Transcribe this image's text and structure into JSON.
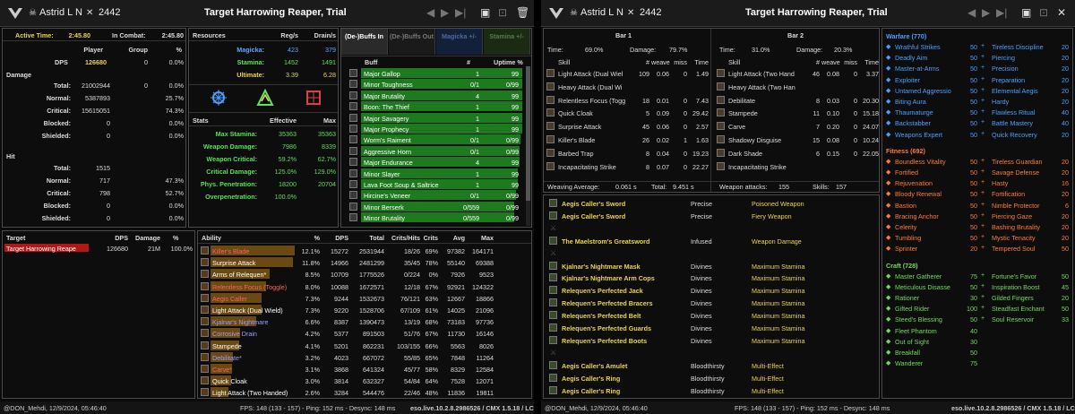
{
  "header": {
    "skull": "☠",
    "player": "Astrid L N",
    "bow": "✕",
    "number": "2442",
    "title": "Target Harrowing Reaper, Trial"
  },
  "footer": {
    "user": "@DON_Mehdi, 12/9/2024, 05:46:40",
    "fps": "FPS: 148  (133 - 157)  - Ping: 152 ms - Desync: 148 ms",
    "server": "eso.live.10.2.8.2986526 / CMX 1.5.18 / LC 75"
  },
  "summary": {
    "active_label": "Active Time:",
    "active": "2:45.80",
    "combat_label": "In Combat:",
    "combat": "2:45.80",
    "cols": [
      "Player",
      "Group",
      "%"
    ],
    "dps": [
      "DPS",
      "126680",
      "0",
      "0.0%"
    ],
    "damage_label": "Damage",
    "damage": [
      [
        "Total:",
        "21002944",
        "0",
        "0.0%"
      ],
      [
        "Normal:",
        "5387893",
        "",
        "25.7%"
      ],
      [
        "Critical:",
        "15615051",
        "",
        "74.3%"
      ],
      [
        "Blocked:",
        "0",
        "",
        "0.0%"
      ],
      [
        "Shielded:",
        "0",
        "",
        "0.0%"
      ]
    ],
    "hit_label": "Hit",
    "hit": [
      [
        "Total:",
        "1515",
        "",
        ""
      ],
      [
        "Normal:",
        "717",
        "",
        "47.3%"
      ],
      [
        "Critical:",
        "798",
        "",
        "52.7%"
      ],
      [
        "Blocked:",
        "0",
        "",
        "0.0%"
      ],
      [
        "Shielded:",
        "0",
        "",
        "0.0%"
      ]
    ]
  },
  "resources": {
    "cols": [
      "Resources",
      "Reg/s",
      "Drain/s"
    ],
    "rows": [
      [
        "Magicka:",
        "423",
        "379",
        "#5aa8ff"
      ],
      [
        "Stamina:",
        "1452",
        "1491",
        "#60e060"
      ],
      [
        "Ultimate:",
        "3.39",
        "6.28",
        "#e8d44d"
      ]
    ]
  },
  "stats": {
    "cols": [
      "Stats",
      "Effective",
      "Max"
    ],
    "rows": [
      [
        "Max Stamina:",
        "35363",
        "35363"
      ],
      [
        "Weapon Damage:",
        "7986",
        "8339"
      ],
      [
        "Weapon Critical:",
        "59.2%",
        "62.7%"
      ],
      [
        "Critical Damage:",
        "125.0%",
        "129.0%"
      ],
      [
        "Phys. Penetration:",
        "18200",
        "20704"
      ],
      [
        "Overpenetration:",
        "100.0%",
        ""
      ]
    ]
  },
  "buffs": {
    "tabs": [
      "(De-)Buffs In",
      "(De-)Buffs Out",
      "Magicka +/-",
      "Stamina +/-"
    ],
    "cols": [
      "Buff",
      "#",
      "Uptime %"
    ],
    "rows": [
      [
        "Major Gallop",
        "1",
        "99",
        "#1e7a1e",
        0.99
      ],
      [
        "Minor Toughness",
        "0/1",
        "0/99",
        "#1e7a1e",
        0.99
      ],
      [
        "Major Brutality",
        "4",
        "99",
        "#1e7a1e",
        0.99
      ],
      [
        "Boon: The Thief",
        "1",
        "99",
        "#1e7a1e",
        0.99
      ],
      [
        "Major Savagery",
        "1",
        "99",
        "#1e7a1e",
        0.99
      ],
      [
        "Major Prophecy",
        "1",
        "99",
        "#1e7a1e",
        0.99
      ],
      [
        "Worm's Raiment",
        "0/1",
        "0/99",
        "#1e7a1e",
        0.98
      ],
      [
        "Aggressive Horn",
        "0/1",
        "0/99",
        "#1e7a1e",
        0.97
      ],
      [
        "Major Endurance",
        "4",
        "99",
        "#1e7a1e",
        0.97
      ],
      [
        "Minor Slayer",
        "1",
        "99",
        "#1e7a1e",
        0.96
      ],
      [
        "Lava Foot Soup & Saltrice",
        "1",
        "99",
        "#1e7a1e",
        0.96
      ],
      [
        "Hircine's Veneer",
        "0/1",
        "0/99",
        "#1e7a1e",
        0.95
      ],
      [
        "Minor Berserk",
        "0/559",
        "0/99",
        "#1e7a1e",
        0.94
      ],
      [
        "Minor Brutality",
        "0/559",
        "0/99",
        "#1e7a1e",
        0.94
      ]
    ]
  },
  "targets": {
    "cols": [
      "Target",
      "DPS",
      "Damage",
      "%"
    ],
    "rows": [
      [
        "Target Harrowing Reape",
        "126680",
        "21M",
        "100.0%"
      ]
    ]
  },
  "abilities": {
    "cols": [
      "Ability",
      "%",
      "DPS",
      "Total",
      "Crits/Hits",
      "Crits",
      "Avg",
      "Max"
    ],
    "rows": [
      [
        "Killer's Blade",
        "12.1%",
        "15272",
        "2531944",
        "18/26",
        "69%",
        "97382",
        "164171",
        "#ff6060"
      ],
      [
        "Surprise Attack",
        "11.8%",
        "14966",
        "2481299",
        "35/45",
        "78%",
        "55140",
        "69388",
        "#ffffff"
      ],
      [
        "Arms of Relequen*",
        "8.5%",
        "10709",
        "1775526",
        "0/224",
        "0%",
        "7926",
        "9523",
        "#ffffff"
      ],
      [
        "Relentless Focus (Toggle)",
        "8.0%",
        "10088",
        "1672571",
        "12/18",
        "67%",
        "92921",
        "124322",
        "#ff6060"
      ],
      [
        "Aegis Caller",
        "7.3%",
        "9244",
        "1532673",
        "76/121",
        "63%",
        "12667",
        "18866",
        "#ff6060"
      ],
      [
        "Light Attack (Dual Wield)",
        "7.3%",
        "9220",
        "1528706",
        "67/109",
        "61%",
        "14025",
        "21096",
        "#ffffff"
      ],
      [
        "Kjalnar's Nightmare",
        "6.6%",
        "8387",
        "1390473",
        "13/19",
        "68%",
        "73183",
        "97736",
        "#9f9fff"
      ],
      [
        "Corrosive Drain",
        "4.2%",
        "5377",
        "891503",
        "51/76",
        "67%",
        "11730",
        "16146",
        "#9f9fff"
      ],
      [
        "Stampede",
        "4.1%",
        "5201",
        "862231",
        "103/155",
        "66%",
        "5563",
        "8026",
        "#ffffff"
      ],
      [
        "Debilitate*",
        "3.2%",
        "4023",
        "667072",
        "55/85",
        "65%",
        "7848",
        "11264",
        "#9f9fff"
      ],
      [
        "Carve*",
        "3.1%",
        "3868",
        "641324",
        "45/77",
        "58%",
        "8329",
        "12584",
        "#ff6060"
      ],
      [
        "Quick Cloak",
        "3.0%",
        "3814",
        "632327",
        "54/84",
        "64%",
        "7528",
        "12071",
        "#ffffff"
      ],
      [
        "Light Attack (Two Handed)",
        "2.6%",
        "3284",
        "544476",
        "22/46",
        "48%",
        "11836",
        "19811",
        "#ffffff"
      ]
    ]
  },
  "bars": {
    "bar1": {
      "title": "Bar 1",
      "time_label": "Time:",
      "time": "69.0%",
      "damage_label": "Damage:",
      "damage": "79.7%"
    },
    "bar2": {
      "title": "Bar 2",
      "time_label": "Time:",
      "time": "31.0%",
      "damage_label": "Damage:",
      "damage": "20.3%"
    },
    "cols": [
      "Skill",
      "#",
      "weave",
      "miss",
      "Time"
    ],
    "rows1": [
      [
        "Light Attack (Dual Wiel",
        "109",
        "0.06",
        "0",
        "1.49"
      ],
      [
        "Heavy Attack (Dual Wi",
        "",
        "",
        "",
        ""
      ],
      [
        "Relentless Focus (Togg",
        "18",
        "0.01",
        "0",
        "7.43"
      ],
      [
        "Quick Cloak",
        "5",
        "0.09",
        "0",
        "29.42"
      ],
      [
        "Surprise Attack",
        "45",
        "0.06",
        "0",
        "2.57"
      ],
      [
        "Killer's Blade",
        "26",
        "0.02",
        "1",
        "1.63"
      ],
      [
        "Barbed Trap",
        "8",
        "0.04",
        "0",
        "19.23"
      ],
      [
        "Incapacitating Strike",
        "8",
        "0.07",
        "0",
        "22.27"
      ]
    ],
    "rows2": [
      [
        "Light Attack (Two Hand",
        "46",
        "0.08",
        "0",
        "3.37"
      ],
      [
        "Heavy Attack (Two Han",
        "",
        "",
        "",
        ""
      ],
      [
        "Debilitate",
        "8",
        "0.03",
        "0",
        "20.30"
      ],
      [
        "Stampede",
        "11",
        "0.10",
        "0",
        "15.18"
      ],
      [
        "Carve",
        "7",
        "0.20",
        "0",
        "24.07"
      ],
      [
        "Shadowy Disguise",
        "15",
        "0.08",
        "0",
        "10.24"
      ],
      [
        "Dark Shade",
        "6",
        "0.15",
        "0",
        "22.05"
      ],
      [
        "Incapacitating Strike",
        "",
        "",
        "",
        ""
      ]
    ],
    "weave_avg_label": "Weaving Average:",
    "weave_avg": "0.061 s",
    "total_label": "Total:",
    "total": "9.451 s",
    "weapon_attacks_label": "Weapon attacks:",
    "weapon_attacks": "155",
    "skills_label": "Skills:",
    "skills": "157"
  },
  "gear": [
    [
      "Aegis Caller's Sword",
      "Precise",
      "Poisoned Weapon"
    ],
    [
      "Aegis Caller's Sword",
      "Precise",
      "Fiery Weapon"
    ],
    [
      "",
      "",
      " "
    ],
    [
      "The Maelstrom's Greatsword",
      "Infused",
      "Weapon Damage"
    ],
    [
      "",
      "",
      ""
    ],
    [
      "Kjalnar's Nightmare Mask",
      "Divines",
      "Maximum Stamina"
    ],
    [
      "Kjalnar's Nightmare Arm Cops",
      "Divines",
      "Maximum Stamina"
    ],
    [
      "Relequen's Perfected Jack",
      "Divines",
      "Maximum Stamina"
    ],
    [
      "Relequen's Perfected Bracers",
      "Divines",
      "Maximum Stamina"
    ],
    [
      "Relequen's Perfected Belt",
      "Divines",
      "Maximum Stamina"
    ],
    [
      "Relequen's Perfected Guards",
      "Divines",
      "Maximum Stamina"
    ],
    [
      "Relequen's Perfected Boots",
      "Divines",
      "Maximum Stamina"
    ],
    [
      "",
      "",
      ""
    ],
    [
      "Aegis Caller's Amulet",
      "Bloodthirsty",
      "Multi-Effect"
    ],
    [
      "Aegis Caller's Ring",
      "Bloodthirsty",
      "Multi-Effect"
    ],
    [
      "Aegis Caller's Ring",
      "Bloodthirsty",
      "Multi-Effect"
    ]
  ],
  "cp": {
    "warfare": {
      "title": "Warfare (770)",
      "color": "#4aa0ff",
      "left": [
        [
          "Wrathful Strikes",
          "50"
        ],
        [
          "Deadly Aim",
          "50"
        ],
        [
          "Master-at-Arms",
          "50"
        ],
        [
          "Exploiter",
          "50"
        ],
        [
          "Untamed Aggressio",
          "50"
        ],
        [
          "Biting Aura",
          "50"
        ],
        [
          "Thaumaturge",
          "50"
        ],
        [
          "Backstabber",
          "50"
        ],
        [
          "Weapons Expert",
          "50"
        ]
      ],
      "right": [
        [
          "Tireless Discipline",
          "20"
        ],
        [
          "Piercing",
          "20"
        ],
        [
          "Precision",
          "20"
        ],
        [
          "Preparation",
          "20"
        ],
        [
          "Elemental Aegis",
          "20"
        ],
        [
          "Hardy",
          "20"
        ],
        [
          "Flawless Ritual",
          "40"
        ],
        [
          "Battle Mastery",
          "40"
        ],
        [
          "Quick Recovery",
          "20"
        ]
      ]
    },
    "fitness": {
      "title": "Fitness (692)",
      "color": "#ff7a3a",
      "left": [
        [
          "Boundless Vitality",
          "50"
        ],
        [
          "Fortified",
          "50"
        ],
        [
          "Rejuvenation",
          "50"
        ],
        [
          "Bloody Renewal",
          "50"
        ],
        [
          "Bastion",
          "50"
        ],
        [
          "Bracing Anchor",
          "50"
        ],
        [
          "Celerity",
          "50"
        ],
        [
          "Tumbling",
          "50"
        ],
        [
          "Sprinter",
          "20"
        ]
      ],
      "right": [
        [
          "Tireless Guardian",
          "20"
        ],
        [
          "Savage Defense",
          "20"
        ],
        [
          "Hasty",
          "16"
        ],
        [
          "Fortification",
          "20"
        ],
        [
          "Nimble Protector",
          "6"
        ],
        [
          "Piercing Gaze",
          "20"
        ],
        [
          "Bashing Brutality",
          "20"
        ],
        [
          "Mystic Tenacity",
          "20"
        ],
        [
          "Tempered Soul",
          "50"
        ]
      ]
    },
    "craft": {
      "title": "Craft (728)",
      "color": "#6fdc5a",
      "left": [
        [
          "Master Gatherer",
          "75"
        ],
        [
          "Meticulous Disasse",
          "50"
        ],
        [
          "Rationer",
          "30"
        ],
        [
          "Gifted Rider",
          "100"
        ],
        [
          "Steed's Blessing",
          "50"
        ],
        [
          "Fleet Phantom",
          "40"
        ],
        [
          "Out of Sight",
          "30"
        ],
        [
          "Breakfall",
          "50"
        ],
        [
          "Wanderer",
          "75"
        ]
      ],
      "right": [
        [
          "Fortune's Favor",
          "50"
        ],
        [
          "Inspiration Boost",
          "45"
        ],
        [
          "Gilded Fingers",
          "20"
        ],
        [
          "Steadfast Enchant",
          "50"
        ],
        [
          "Soul Reservoir",
          "33"
        ]
      ]
    }
  }
}
